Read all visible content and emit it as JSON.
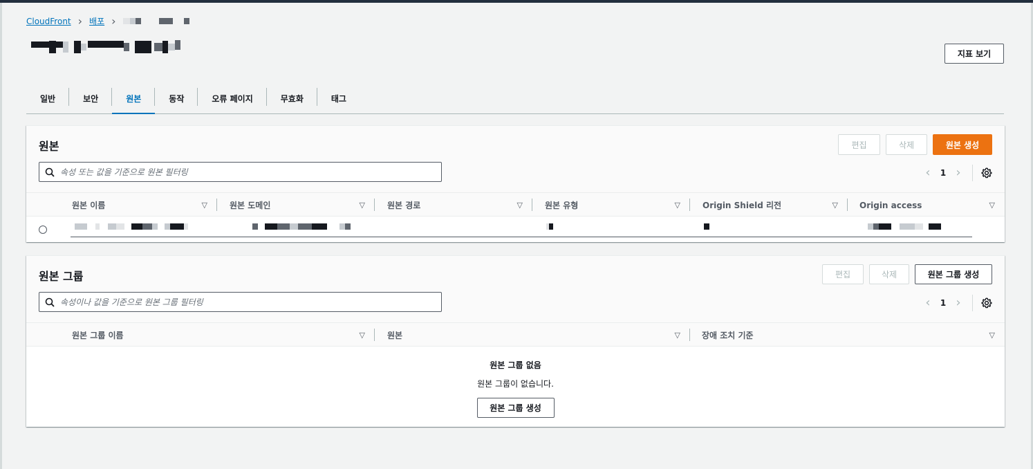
{
  "breadcrumb": {
    "root": "CloudFront",
    "distributions": "배포"
  },
  "header": {
    "metrics_button": "지표 보기"
  },
  "tabs": [
    {
      "label": "일반",
      "active": false
    },
    {
      "label": "보안",
      "active": false
    },
    {
      "label": "원본",
      "active": true
    },
    {
      "label": "동작",
      "active": false
    },
    {
      "label": "오류 페이지",
      "active": false
    },
    {
      "label": "무효화",
      "active": false
    },
    {
      "label": "태그",
      "active": false
    }
  ],
  "origins": {
    "title": "원본",
    "edit": "편집",
    "delete": "삭제",
    "create": "원본 생성",
    "filter_placeholder": "속성 또는 값을 기준으로 원본 필터링",
    "page": "1",
    "columns": [
      "원본 이름",
      "원본 도메인",
      "원본 경로",
      "원본 유형",
      "Origin Shield 리전",
      "Origin access"
    ]
  },
  "origin_groups": {
    "title": "원본 그룹",
    "edit": "편집",
    "delete": "삭제",
    "create": "원본 그룹 생성",
    "filter_placeholder": "속성이나 값을 기준으로 원본 그룹 필터링",
    "page": "1",
    "columns": [
      "원본 그룹 이름",
      "원본",
      "장애 조치 기준"
    ],
    "empty_title": "원본 그룹 없음",
    "empty_desc": "원본 그룹이 없습니다.",
    "empty_button": "원본 그룹 생성"
  },
  "colors": {
    "link": "#0073bb",
    "primary": "#ec7211",
    "text": "#16191f"
  }
}
